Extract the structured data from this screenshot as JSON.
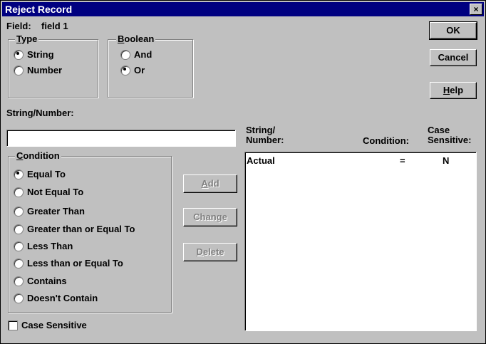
{
  "window": {
    "title": "Reject Record",
    "close_glyph": "×"
  },
  "field": {
    "label": "Field:",
    "value": "field 1"
  },
  "type_group": {
    "legend_u": "T",
    "legend_rest": "ype",
    "options": [
      "String",
      "Number"
    ],
    "selected": "String"
  },
  "boolean_group": {
    "legend_u": "B",
    "legend_rest": "oolean",
    "options": [
      "And",
      "Or"
    ],
    "selected": "Or"
  },
  "string_number": {
    "label": "String/Number:",
    "value": ""
  },
  "condition_group": {
    "legend_u": "C",
    "legend_rest": "ondition",
    "options": [
      "Equal To",
      "Not Equal To",
      "Greater Than",
      "Greater than or Equal To",
      "Less Than",
      "Less than or Equal To",
      "Contains",
      "Doesn't Contain"
    ],
    "selected": "Equal To"
  },
  "buttons": {
    "ok": "OK",
    "cancel": "Cancel",
    "help_u": "H",
    "help_rest": "elp",
    "add_u": "A",
    "add_rest": "dd",
    "change_pre": "Chan",
    "change_u": "g",
    "change_post": "e",
    "delete_u": "D",
    "delete_rest": "elete"
  },
  "list": {
    "headers": {
      "col1_line1": "String/",
      "col1_line2": "Number:",
      "col2": "Condition:",
      "col3_line1": "Case",
      "col3_line2": "Sensitive:"
    },
    "rows": [
      {
        "value": "Actual",
        "condition": "=",
        "case": "N"
      }
    ]
  },
  "case_sensitive": {
    "label": "Case Sensitive",
    "checked": false
  }
}
